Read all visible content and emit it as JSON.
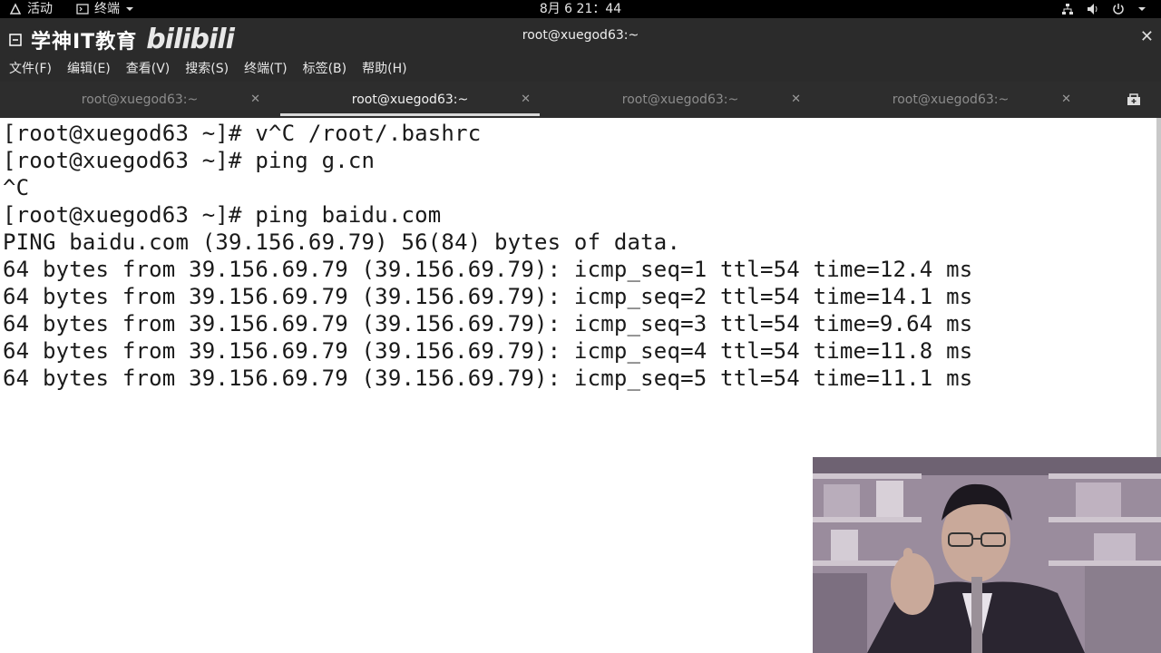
{
  "topbar": {
    "activities": "活动",
    "terminal_app": "终端",
    "clock": "8月 6  21：44"
  },
  "window": {
    "title": "root@xuegod63:~",
    "brand": "学神IT教育",
    "watermark": "bilibili"
  },
  "menu": [
    "文件(F)",
    "编辑(E)",
    "查看(V)",
    "搜索(S)",
    "终端(T)",
    "标签(B)",
    "帮助(H)"
  ],
  "tabs": [
    {
      "label": "root@xuegod63:~",
      "active": false
    },
    {
      "label": "root@xuegod63:~",
      "active": true
    },
    {
      "label": "root@xuegod63:~",
      "active": false
    },
    {
      "label": "root@xuegod63:~",
      "active": false
    }
  ],
  "terminal": {
    "lines": [
      "[root@xuegod63 ~]# v^C /root/.bashrc",
      "[root@xuegod63 ~]# ping g.cn",
      "^C",
      "[root@xuegod63 ~]# ping baidu.com",
      "PING baidu.com (39.156.69.79) 56(84) bytes of data.",
      "64 bytes from 39.156.69.79 (39.156.69.79): icmp_seq=1 ttl=54 time=12.4 ms",
      "64 bytes from 39.156.69.79 (39.156.69.79): icmp_seq=2 ttl=54 time=14.1 ms",
      "64 bytes from 39.156.69.79 (39.156.69.79): icmp_seq=3 ttl=54 time=9.64 ms",
      "64 bytes from 39.156.69.79 (39.156.69.79): icmp_seq=4 ttl=54 time=11.8 ms",
      "64 bytes from 39.156.69.79 (39.156.69.79): icmp_seq=5 ttl=54 time=11.1 ms"
    ]
  },
  "icons": {
    "activities": "activities-icon",
    "terminal": "terminal-app-icon",
    "dropdown": "chevron-down-icon",
    "network": "network-icon",
    "volume": "volume-icon",
    "power": "power-icon",
    "close": "close-icon",
    "new_tab": "new-tab-icon"
  }
}
